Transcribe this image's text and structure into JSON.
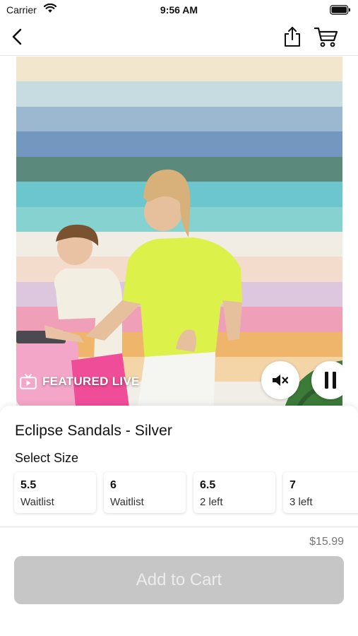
{
  "status_bar": {
    "carrier": "Carrier",
    "time": "9:56 AM"
  },
  "nav": {
    "back_icon": "chevron-left-icon",
    "share_icon": "share-icon",
    "cart_icon": "cart-icon"
  },
  "video": {
    "badge_icon": "tv-icon",
    "badge_label": "FEATURED LIVE",
    "mute_icon": "speaker-mute-icon",
    "pause_icon": "pause-icon",
    "stripe_colors": [
      "#f2e6cc",
      "#c7dce0",
      "#9bb8d0",
      "#7397bf",
      "#5b8a7c",
      "#6cc6cd",
      "#86d2d0",
      "#f1ede5",
      "#f4dccd",
      "#dcc7de",
      "#ef9fb8",
      "#efb56b",
      "#f3d5a8",
      "#f1eee8"
    ]
  },
  "product": {
    "title": "Eclipse Sandals - Silver",
    "size_heading": "Select Size",
    "sizes": [
      {
        "value": "5.5",
        "status": "Waitlist"
      },
      {
        "value": "6",
        "status": "Waitlist"
      },
      {
        "value": "6.5",
        "status": "2 left"
      },
      {
        "value": "7",
        "status": "3 left"
      }
    ],
    "price": "$15.99",
    "add_to_cart_label": "Add to Cart"
  },
  "colors": {
    "button_disabled": "#c6c6c6",
    "button_text": "#ececec",
    "price_text": "#777777"
  }
}
